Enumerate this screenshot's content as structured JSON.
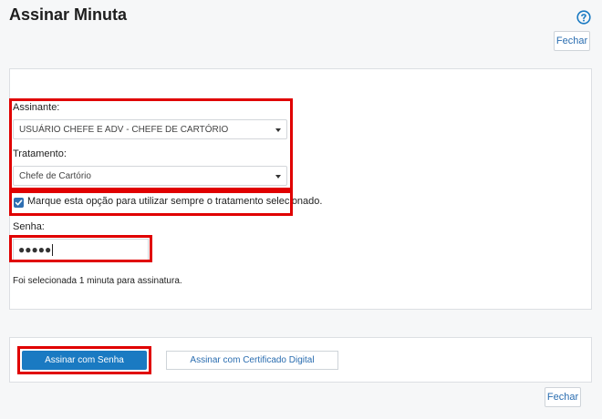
{
  "header": {
    "title": "Assinar Minuta",
    "help_icon": "question-circle-icon",
    "close_label": "Fechar"
  },
  "form": {
    "signer_label": "Assinante:",
    "signer_value": "USUÁRIO CHEFE E ADV - CHEFE DE CARTÓRIO",
    "treatment_label": "Tratamento:",
    "treatment_value": "Chefe de Cartório",
    "always_use_checked": true,
    "always_use_label": "Marque esta opção para utilizar sempre o tratamento selecionado.",
    "password_label": "Senha:",
    "password_value": "●●●●●",
    "info_text": "Foi selecionada 1 minuta para assinatura."
  },
  "actions": {
    "sign_password_label": "Assinar com Senha",
    "sign_certificate_label": "Assinar com Certificado Digital",
    "close_label": "Fechar"
  },
  "colors": {
    "accent": "#1a7ac2",
    "highlight": "#e00000"
  }
}
